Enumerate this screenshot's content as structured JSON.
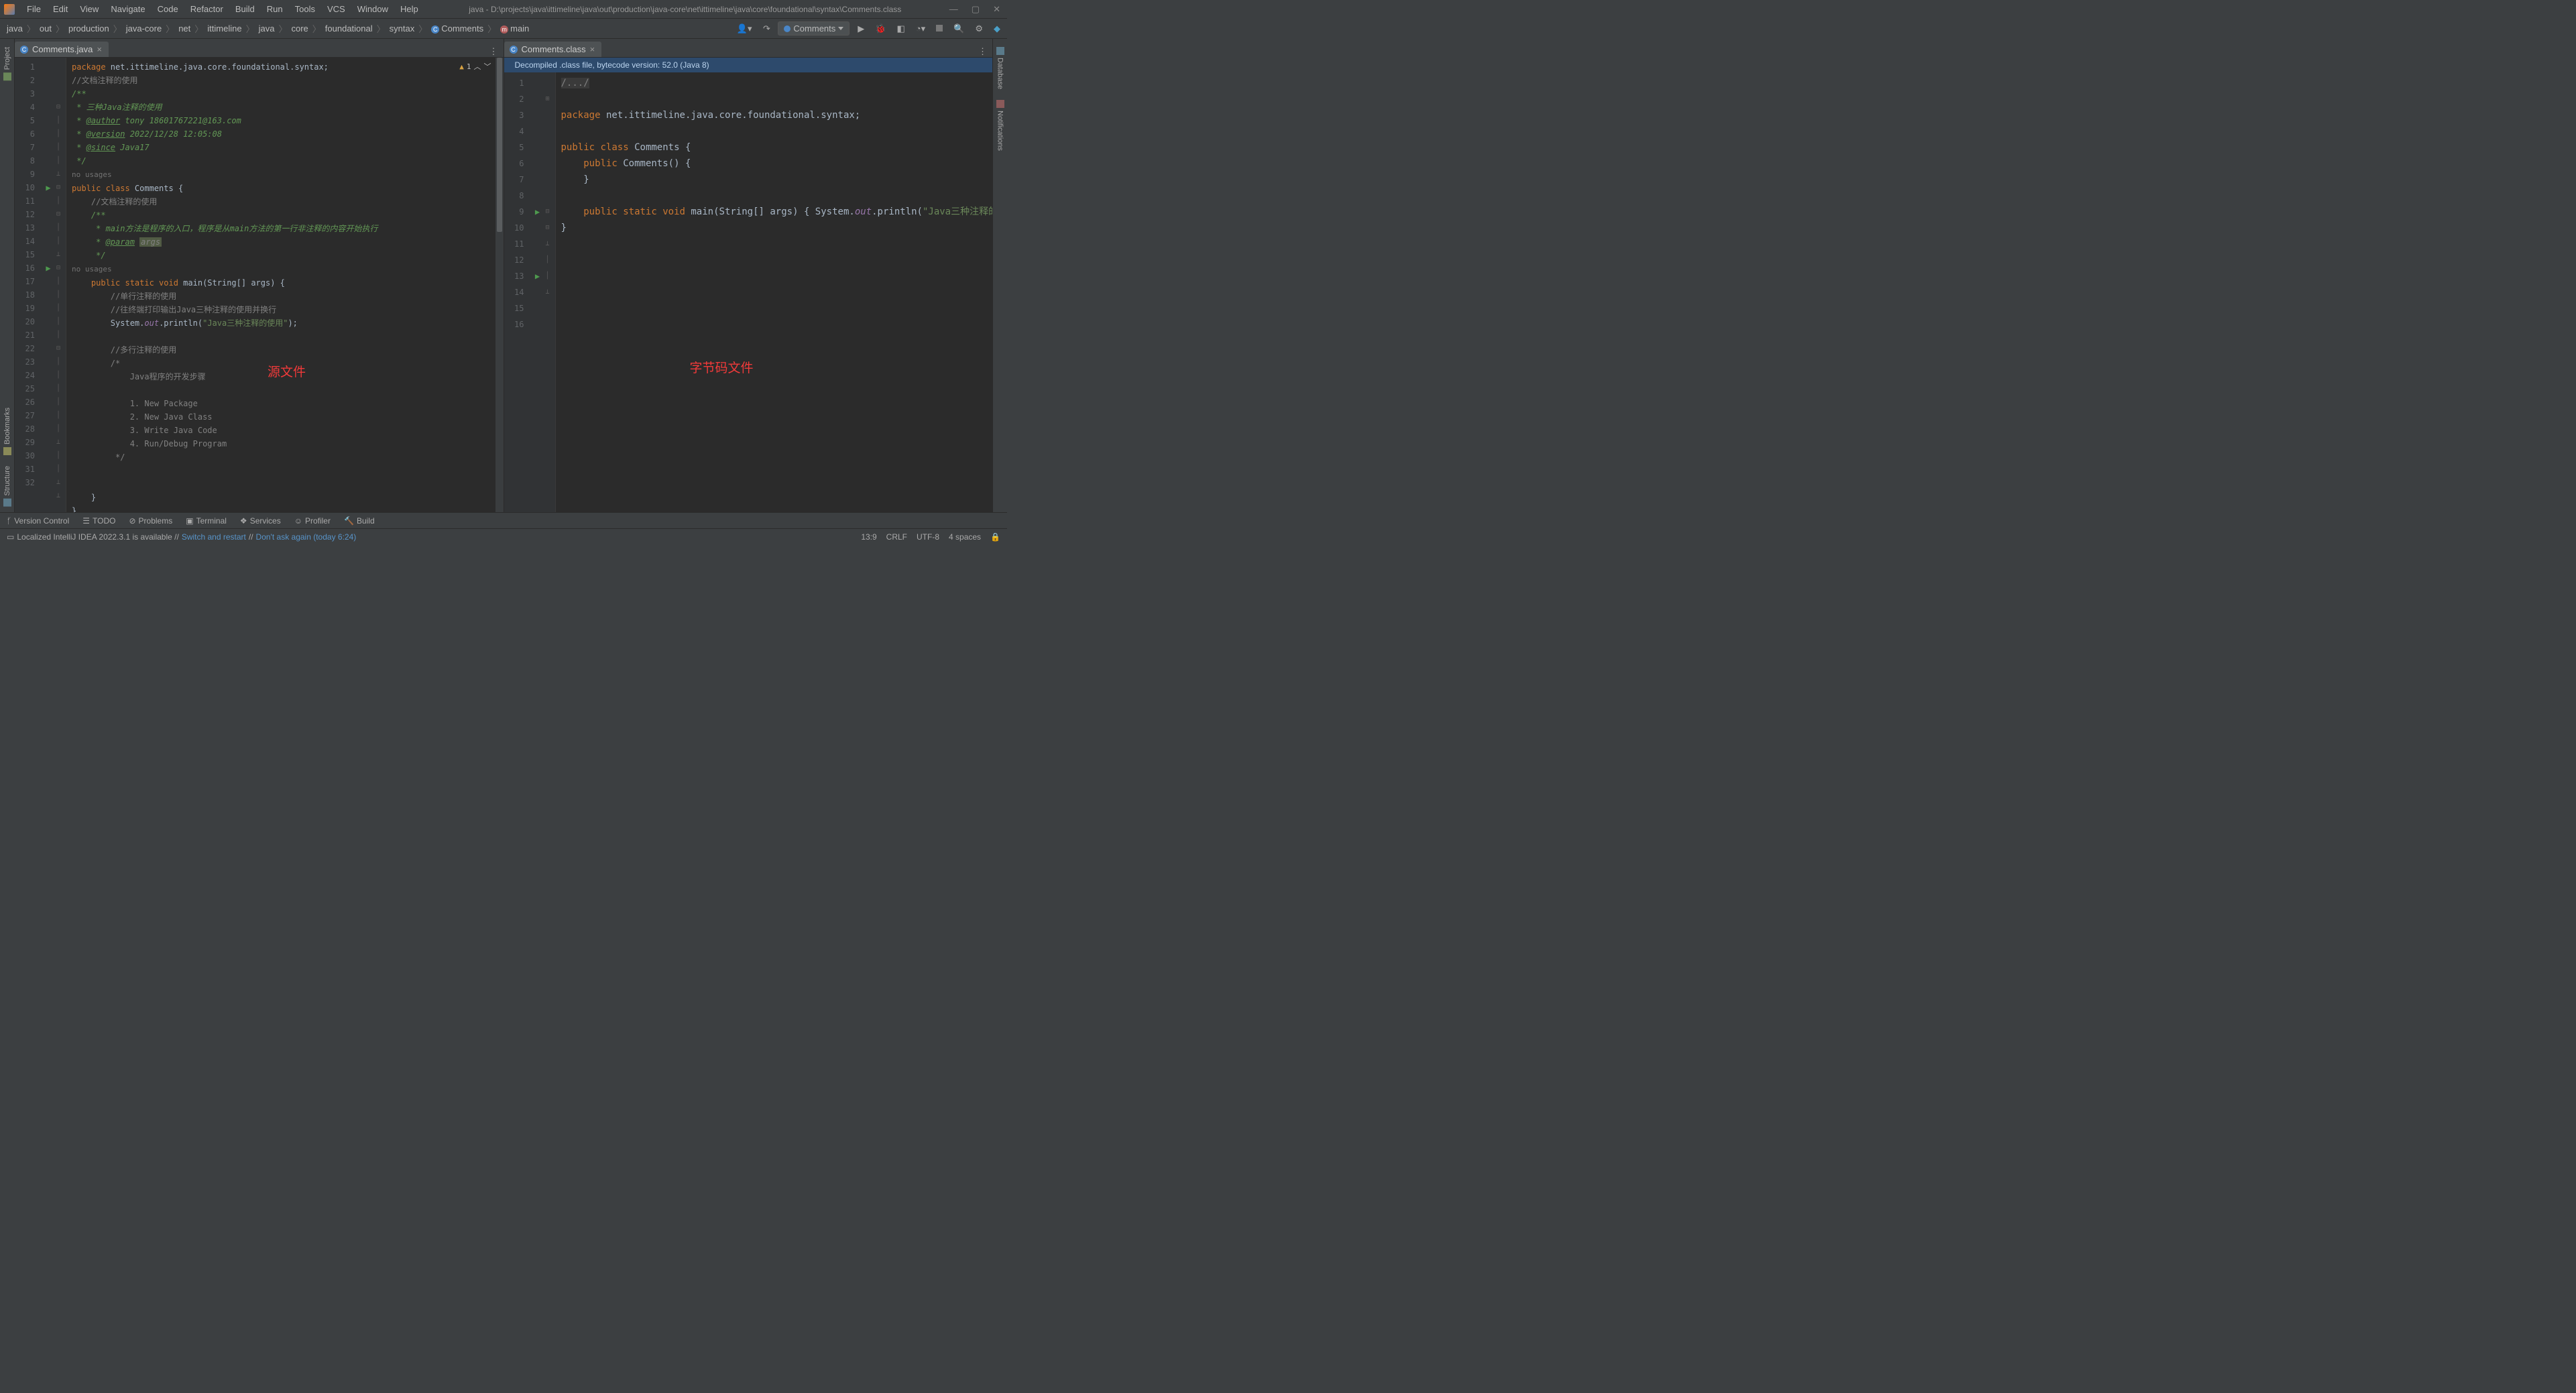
{
  "menu": [
    "File",
    "Edit",
    "View",
    "Navigate",
    "Code",
    "Refactor",
    "Build",
    "Run",
    "Tools",
    "VCS",
    "Window",
    "Help"
  ],
  "window_title": "java - D:\\projects\\java\\ittimeline\\java\\out\\production\\java-core\\net\\ittimeline\\java\\core\\foundational\\syntax\\Comments.class",
  "breadcrumbs": [
    "java",
    "out",
    "production",
    "java-core",
    "net",
    "ittimeline",
    "java",
    "core",
    "foundational",
    "syntax"
  ],
  "crumb_class": "Comments",
  "crumb_method": "main",
  "run_config": "Comments",
  "left_tabs": [
    {
      "label": "Project",
      "icon": "project-icon"
    },
    {
      "label": "Bookmarks",
      "icon": "bookmarks-icon"
    },
    {
      "label": "Structure",
      "icon": "structure-icon"
    }
  ],
  "right_tabs": [
    {
      "label": "Database",
      "icon": "database-icon"
    },
    {
      "label": "Notifications",
      "icon": "notifications-icon"
    }
  ],
  "pane_left": {
    "tab": "Comments.java",
    "warn_count": "1",
    "overlay": "源文件",
    "lines": [
      "1",
      "2",
      "3",
      "4",
      "5",
      "6",
      "7",
      "8",
      "9",
      "10",
      "11",
      "12",
      "13",
      "14",
      "15",
      "16",
      "17",
      "18",
      "19",
      "20",
      "21",
      "22",
      "23",
      "24",
      "25",
      "26",
      "27",
      "28",
      "29",
      "30",
      "31",
      "32"
    ],
    "usage_hint": "no usages",
    "code": {
      "l1a": "package",
      "l1b": " net.ittimeline.java.core.foundational.syntax;",
      "l2": "//文档注释的使用",
      "l3": "/**",
      "l4": " * 三种Java注释的使用",
      "l5a": " * ",
      "l5t": "@author",
      "l5b": " tony 18601767221@163.com",
      "l6a": " * ",
      "l6t": "@version",
      "l6b": " 2022/12/28 12:05:08",
      "l7a": " * ",
      "l7t": "@since",
      "l7b": " Java17",
      "l8": " */",
      "l9a": "public class",
      "l9b": " Comments {",
      "l10": "    //文档注释的使用",
      "l11": "    /**",
      "l12": "     * main方法是程序的入口，程序是从main方法的第一行非注释的内容开始执行",
      "l13a": "     * ",
      "l13t": "@param",
      "l13b": " ",
      "l13p": "args",
      "l14": "     */",
      "l15a": "    public static void",
      "l15b": " main(String[] args) {",
      "l16": "        //单行注释的使用",
      "l17": "        //往终端打印输出Java三种注释的使用并换行",
      "l18a": "        System.",
      "l18f": "out",
      "l18b": ".println(",
      "l18s": "\"Java三种注释的使用\"",
      "l18c": ");",
      "l19": "",
      "l20": "        //多行注释的使用",
      "l21": "        /*",
      "l22": "            Java程序的开发步骤",
      "l23": "",
      "l24": "            1. New Package",
      "l25": "            2. New Java Class",
      "l26": "            3. Write Java Code",
      "l27": "            4. Run/Debug Program",
      "l28": "         */",
      "l29": "",
      "l30": "",
      "l31": "    }",
      "l32": "}"
    }
  },
  "pane_right": {
    "tab": "Comments.class",
    "banner": "Decompiled .class file, bytecode version: 52.0 (Java 8)",
    "overlay": "字节码文件",
    "lines": [
      "1",
      "2",
      "3",
      "4",
      "5",
      "6",
      "7",
      "8",
      "9",
      "10",
      "11",
      "12",
      "13",
      "14",
      "15",
      "16"
    ],
    "code": {
      "l1": "/.../",
      "l3a": "package",
      "l3b": " net.ittimeline.java.core.foundational.syntax;",
      "l5a": "public class",
      "l5b": " Comments {",
      "l6a": "    public",
      "l6b": " Comments() {",
      "l7": "    }",
      "l9a": "    public static void",
      "l9b": " main(String[] args) { System.",
      "l9f": "out",
      "l9c": ".println(",
      "l9s": "\"Java三种注释的使用\"",
      "l9d": "); }",
      "l10": "}"
    }
  },
  "bottom_tools": {
    "vcs": "Version Control",
    "todo": "TODO",
    "problems": "Problems",
    "terminal": "Terminal",
    "services": "Services",
    "profiler": "Profiler",
    "build": "Build"
  },
  "status": {
    "msg_a": "Localized IntelliJ IDEA 2022.3.1 is available // ",
    "msg_b": "Switch and restart",
    "msg_c": " // ",
    "msg_d": "Don't ask again (today 6:24)",
    "pos": "13:9",
    "eol": "CRLF",
    "enc": "UTF-8",
    "indent": "4 spaces"
  }
}
